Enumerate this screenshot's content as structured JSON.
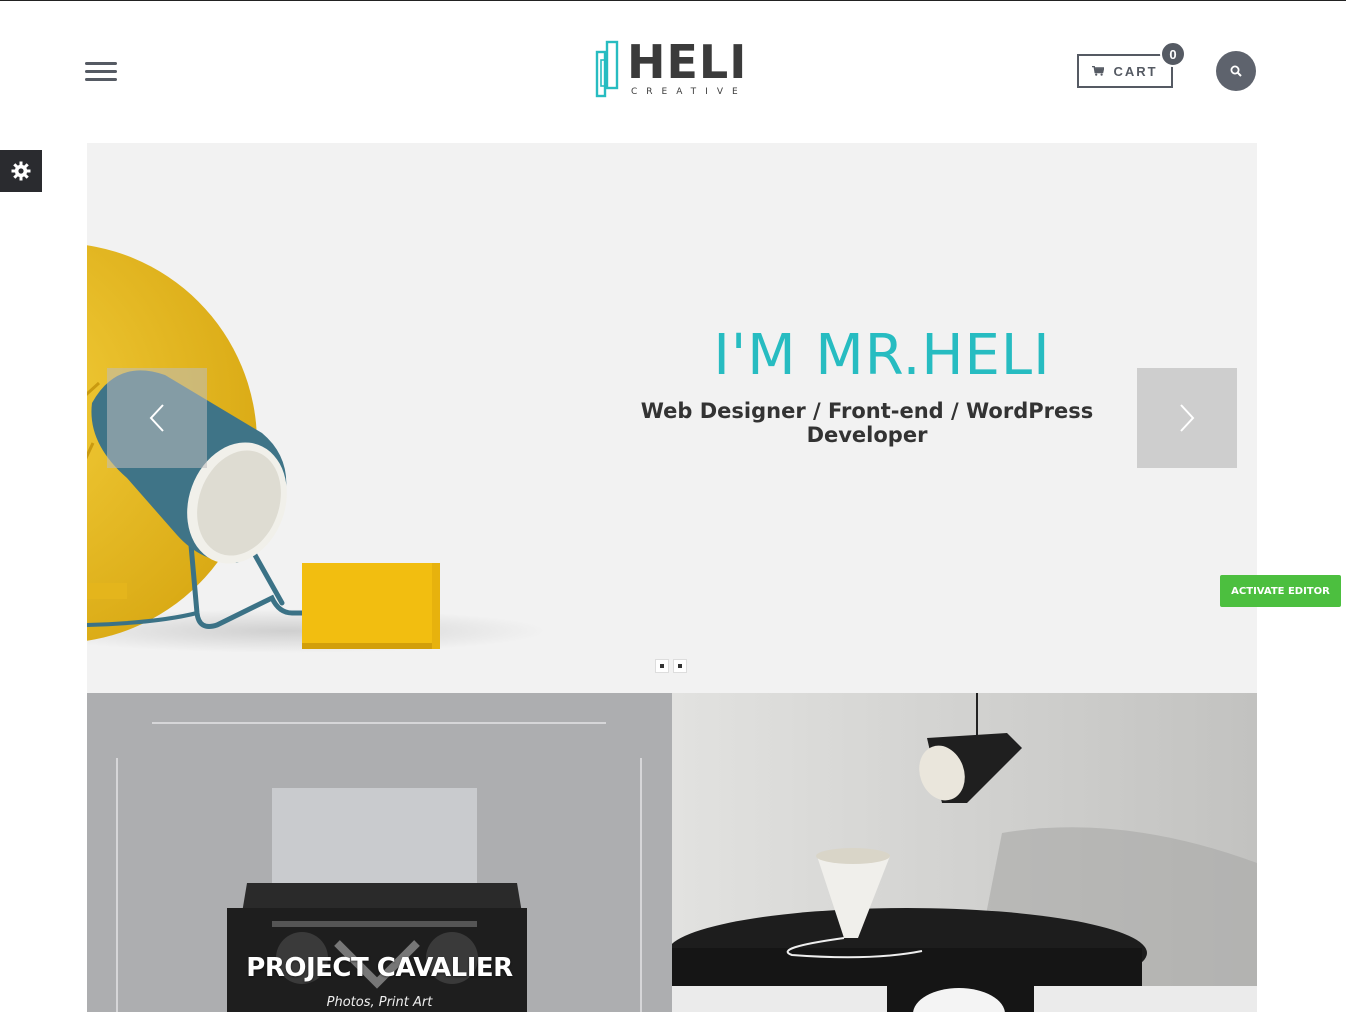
{
  "header": {
    "logo": {
      "word": "HELI",
      "tagline": "CREATIVE"
    },
    "cart": {
      "label": "CART",
      "count": "0",
      "icon": "shopping-cart-icon"
    },
    "search": {
      "icon": "search-icon"
    },
    "menu": {
      "icon": "hamburger-icon"
    }
  },
  "settings": {
    "icon": "gear-icon"
  },
  "slider": {
    "title": "I'M MR.HELI",
    "subtitle": "Web Designer / Front-end / WordPress Developer",
    "slide_count": 2,
    "active_slide": 1
  },
  "editor": {
    "label": "ACTIVATE EDITOR"
  },
  "portfolio": {
    "items": [
      {
        "title": "PROJECT CAVALIER",
        "category": "Photos, Print Art"
      }
    ]
  },
  "colors": {
    "accent": "#27bcc1",
    "dark": "#555a63",
    "editor": "#4cbf3f"
  }
}
